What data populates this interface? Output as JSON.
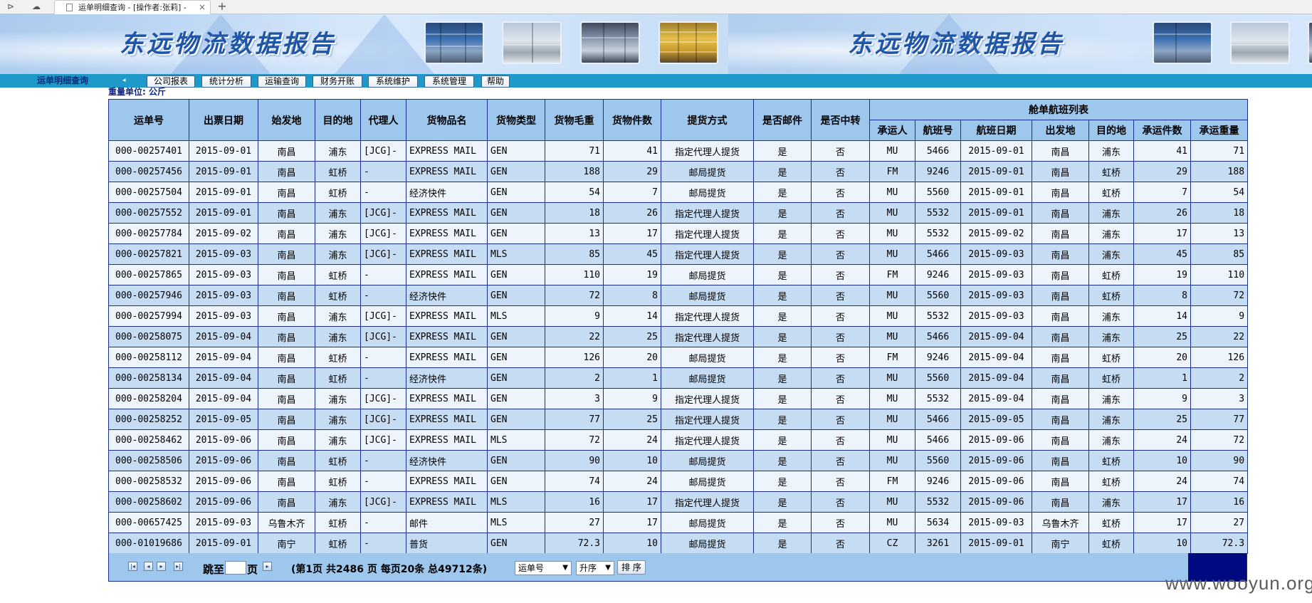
{
  "browser": {
    "tab_title": "运单明细查询 - [操作者:张莉] -",
    "tab_close": "×",
    "new_tab": "+"
  },
  "banner": {
    "title_left": "东远物流数据报告",
    "title_right": "东远物流数据报告"
  },
  "nav": {
    "page_label": "运单明细查询",
    "menu": [
      "公司报表",
      "统计分析",
      "运输查询",
      "财务开账",
      "系统维护",
      "系统管理",
      "帮助"
    ]
  },
  "unit_label": "重量单位: 公斤",
  "table": {
    "headers": [
      "运单号",
      "出票日期",
      "始发地",
      "目的地",
      "代理人",
      "货物品名",
      "货物类型",
      "货物毛重",
      "货物件数",
      "提货方式",
      "是否邮件",
      "是否中转"
    ],
    "group_header": "舱单航班列表",
    "sub_headers": [
      "承运人",
      "航班号",
      "航班日期",
      "出发地",
      "目的地",
      "承运件数",
      "承运重量"
    ],
    "rows": [
      [
        "000-00257401",
        "2015-09-01",
        "南昌",
        "浦东",
        "[JCG]-",
        "EXPRESS MAIL",
        "GEN",
        "71",
        "41",
        "指定代理人提货",
        "是",
        "否",
        "MU",
        "5466",
        "2015-09-01",
        "南昌",
        "浦东",
        "41",
        "71"
      ],
      [
        "000-00257456",
        "2015-09-01",
        "南昌",
        "虹桥",
        "-",
        "EXPRESS MAIL",
        "GEN",
        "188",
        "29",
        "邮局提货",
        "是",
        "否",
        "FM",
        "9246",
        "2015-09-01",
        "南昌",
        "虹桥",
        "29",
        "188"
      ],
      [
        "000-00257504",
        "2015-09-01",
        "南昌",
        "虹桥",
        "-",
        "经济快件",
        "GEN",
        "54",
        "7",
        "邮局提货",
        "是",
        "否",
        "MU",
        "5560",
        "2015-09-01",
        "南昌",
        "虹桥",
        "7",
        "54"
      ],
      [
        "000-00257552",
        "2015-09-01",
        "南昌",
        "浦东",
        "[JCG]-",
        "EXPRESS MAIL",
        "GEN",
        "18",
        "26",
        "指定代理人提货",
        "是",
        "否",
        "MU",
        "5532",
        "2015-09-01",
        "南昌",
        "浦东",
        "26",
        "18"
      ],
      [
        "000-00257784",
        "2015-09-02",
        "南昌",
        "浦东",
        "[JCG]-",
        "EXPRESS MAIL",
        "GEN",
        "13",
        "17",
        "指定代理人提货",
        "是",
        "否",
        "MU",
        "5532",
        "2015-09-02",
        "南昌",
        "浦东",
        "17",
        "13"
      ],
      [
        "000-00257821",
        "2015-09-03",
        "南昌",
        "浦东",
        "[JCG]-",
        "EXPRESS MAIL",
        "MLS",
        "85",
        "45",
        "指定代理人提货",
        "是",
        "否",
        "MU",
        "5466",
        "2015-09-03",
        "南昌",
        "浦东",
        "45",
        "85"
      ],
      [
        "000-00257865",
        "2015-09-03",
        "南昌",
        "虹桥",
        "-",
        "EXPRESS MAIL",
        "GEN",
        "110",
        "19",
        "邮局提货",
        "是",
        "否",
        "FM",
        "9246",
        "2015-09-03",
        "南昌",
        "虹桥",
        "19",
        "110"
      ],
      [
        "000-00257946",
        "2015-09-03",
        "南昌",
        "虹桥",
        "-",
        "经济快件",
        "GEN",
        "72",
        "8",
        "邮局提货",
        "是",
        "否",
        "MU",
        "5560",
        "2015-09-03",
        "南昌",
        "虹桥",
        "8",
        "72"
      ],
      [
        "000-00257994",
        "2015-09-03",
        "南昌",
        "浦东",
        "[JCG]-",
        "EXPRESS MAIL",
        "MLS",
        "9",
        "14",
        "指定代理人提货",
        "是",
        "否",
        "MU",
        "5532",
        "2015-09-03",
        "南昌",
        "浦东",
        "14",
        "9"
      ],
      [
        "000-00258075",
        "2015-09-04",
        "南昌",
        "浦东",
        "[JCG]-",
        "EXPRESS MAIL",
        "GEN",
        "22",
        "25",
        "指定代理人提货",
        "是",
        "否",
        "MU",
        "5466",
        "2015-09-04",
        "南昌",
        "浦东",
        "25",
        "22"
      ],
      [
        "000-00258112",
        "2015-09-04",
        "南昌",
        "虹桥",
        "-",
        "EXPRESS MAIL",
        "GEN",
        "126",
        "20",
        "邮局提货",
        "是",
        "否",
        "FM",
        "9246",
        "2015-09-04",
        "南昌",
        "虹桥",
        "20",
        "126"
      ],
      [
        "000-00258134",
        "2015-09-04",
        "南昌",
        "虹桥",
        "-",
        "经济快件",
        "GEN",
        "2",
        "1",
        "邮局提货",
        "是",
        "否",
        "MU",
        "5560",
        "2015-09-04",
        "南昌",
        "虹桥",
        "1",
        "2"
      ],
      [
        "000-00258204",
        "2015-09-04",
        "南昌",
        "浦东",
        "[JCG]-",
        "EXPRESS MAIL",
        "GEN",
        "3",
        "9",
        "指定代理人提货",
        "是",
        "否",
        "MU",
        "5532",
        "2015-09-04",
        "南昌",
        "浦东",
        "9",
        "3"
      ],
      [
        "000-00258252",
        "2015-09-05",
        "南昌",
        "浦东",
        "[JCG]-",
        "EXPRESS MAIL",
        "GEN",
        "77",
        "25",
        "指定代理人提货",
        "是",
        "否",
        "MU",
        "5466",
        "2015-09-05",
        "南昌",
        "浦东",
        "25",
        "77"
      ],
      [
        "000-00258462",
        "2015-09-06",
        "南昌",
        "浦东",
        "[JCG]-",
        "EXPRESS MAIL",
        "MLS",
        "72",
        "24",
        "指定代理人提货",
        "是",
        "否",
        "MU",
        "5466",
        "2015-09-06",
        "南昌",
        "浦东",
        "24",
        "72"
      ],
      [
        "000-00258506",
        "2015-09-06",
        "南昌",
        "虹桥",
        "-",
        "经济快件",
        "GEN",
        "90",
        "10",
        "邮局提货",
        "是",
        "否",
        "MU",
        "5560",
        "2015-09-06",
        "南昌",
        "虹桥",
        "10",
        "90"
      ],
      [
        "000-00258532",
        "2015-09-06",
        "南昌",
        "虹桥",
        "-",
        "EXPRESS MAIL",
        "GEN",
        "74",
        "24",
        "邮局提货",
        "是",
        "否",
        "FM",
        "9246",
        "2015-09-06",
        "南昌",
        "虹桥",
        "24",
        "74"
      ],
      [
        "000-00258602",
        "2015-09-06",
        "南昌",
        "浦东",
        "[JCG]-",
        "EXPRESS MAIL",
        "MLS",
        "16",
        "17",
        "指定代理人提货",
        "是",
        "否",
        "MU",
        "5532",
        "2015-09-06",
        "南昌",
        "浦东",
        "17",
        "16"
      ],
      [
        "000-00657425",
        "2015-09-03",
        "乌鲁木齐",
        "虹桥",
        "-",
        "邮件",
        "MLS",
        "27",
        "17",
        "邮局提货",
        "是",
        "否",
        "MU",
        "5634",
        "2015-09-03",
        "乌鲁木齐",
        "虹桥",
        "17",
        "27"
      ],
      [
        "000-01019686",
        "2015-09-01",
        "南宁",
        "虹桥",
        "-",
        "普货",
        "GEN",
        "72.3",
        "10",
        "邮局提货",
        "是",
        "否",
        "CZ",
        "3261",
        "2015-09-01",
        "南宁",
        "虹桥",
        "10",
        "72.3"
      ]
    ]
  },
  "pager": {
    "jump_prefix": "跳至",
    "jump_suffix": "页",
    "jump_value": "",
    "info": "(第1页 共2486 页 每页20条 总49712条)",
    "sort_field": "运单号",
    "sort_order": "升序",
    "sort_button": "排 序",
    "icons": [
      "first-page-icon",
      "prev-page-icon",
      "next-page-icon",
      "last-page-icon",
      "go-icon"
    ]
  },
  "watermark": "www.wooyun.org",
  "colors": {
    "header_bg": "#9ec7ee",
    "row_odd": "#eef4fb",
    "row_even": "#c6dcf3",
    "border": "#1a2f8f",
    "nav_strip": "#1f99c9"
  }
}
